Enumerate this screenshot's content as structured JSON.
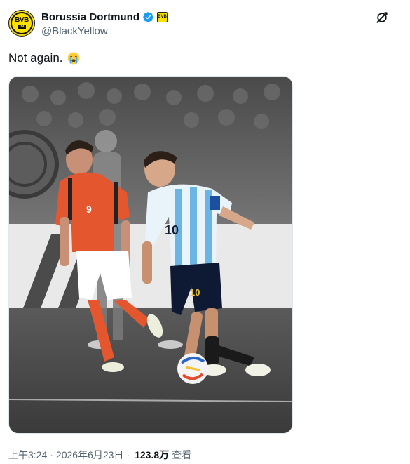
{
  "author": {
    "display_name": "Borussia Dortmund",
    "handle": "@BlackYellow",
    "avatar_text_top": "BVB",
    "avatar_text_bottom": "09",
    "affiliate_badge_text": "BVB"
  },
  "tweet": {
    "text": "Not again.",
    "emoji": "crying-face-emoji"
  },
  "media": {
    "alt_description_icon": "photo",
    "player_left_number": "9",
    "player_right_number": "10"
  },
  "meta": {
    "time": "上午3:24",
    "date": "2026年6月23日",
    "views": "123.8万",
    "views_label": "查看"
  },
  "colors": {
    "brand_yellow": "#fbe000",
    "verified_blue": "#1d9bf0",
    "secondary_text": "#536471",
    "austria_red": "#e4572e",
    "argentina_blue": "#6cb4e4"
  }
}
